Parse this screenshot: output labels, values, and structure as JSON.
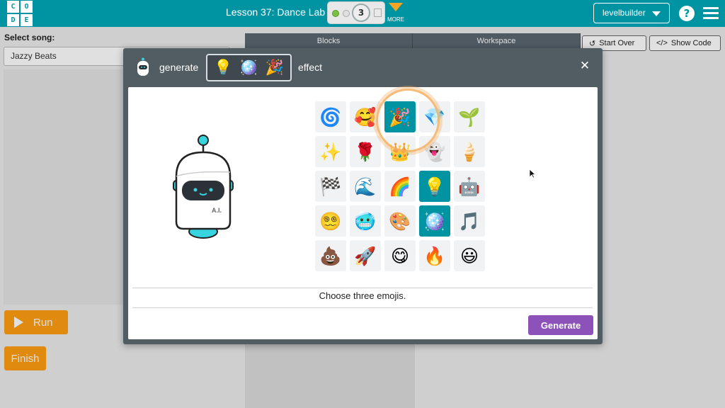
{
  "header": {
    "logo_letters": [
      "C",
      "O",
      "D",
      "E"
    ],
    "lesson_title": "Lesson 37: Dance Lab",
    "level_number": "3",
    "more_label": "MORE",
    "user_label": "levelbuilder",
    "help_label": "?",
    "accent_color": "#0094a3"
  },
  "left_panel": {
    "song_label": "Select song:",
    "song_value": "Jazzy Beats",
    "run_label": "Run",
    "finish_label": "Finish"
  },
  "workspace": {
    "tabs": [
      "Blocks",
      "Workspace"
    ],
    "start_over_label": "Start Over",
    "show_code_label": "Show Code"
  },
  "modal": {
    "generate_label": "generate",
    "effect_label": "effect",
    "close_label": "✕",
    "selected_slots": [
      "💡",
      "🪩",
      "🎉"
    ],
    "robot_badge": "A.I.",
    "emojis": [
      "🌀",
      "🥰",
      "🎉",
      "💎",
      "🌱",
      "✨",
      "🌹",
      "👑",
      "👻",
      "🍦",
      "🏁",
      "🌊",
      "🌈",
      "💡",
      "🤖",
      "😵‍💫",
      "🥶",
      "🎨",
      "🪩",
      "🎵",
      "💩",
      "🚀",
      "😋",
      "🔥",
      "😃"
    ],
    "selected_indices": [
      2,
      13,
      18
    ],
    "focused_index": 2,
    "instruction": "Choose three emojis.",
    "generate_button": "Generate",
    "generate_color": "#8c52ba"
  }
}
